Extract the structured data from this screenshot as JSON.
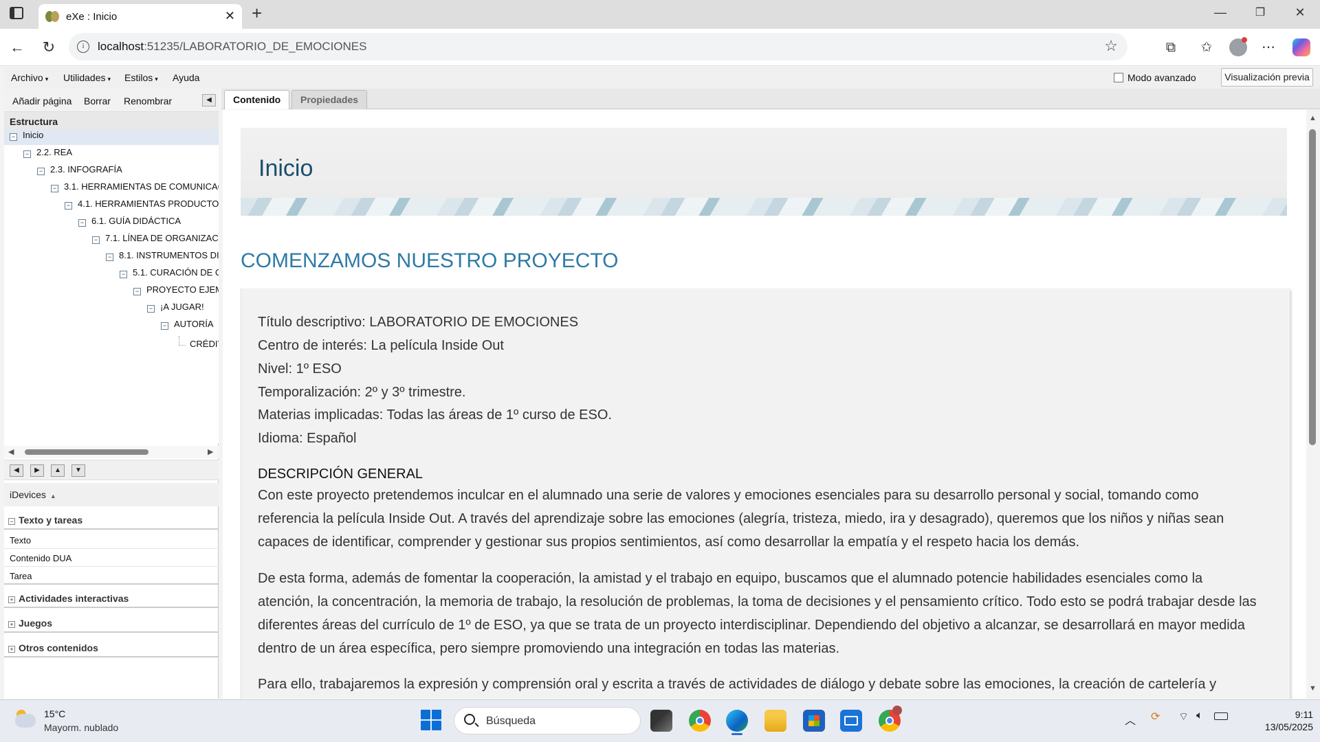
{
  "browser": {
    "tab_title": "eXe : Inicio",
    "url_host": "localhost",
    "url_rest": ":51235/LABORATORIO_DE_EMOCIONES"
  },
  "menu": {
    "archivo": "Archivo",
    "utilidades": "Utilidades",
    "estilos": "Estilos",
    "ayuda": "Ayuda",
    "modo_avanzado": "Modo avanzado",
    "visualizacion_previa": "Visualización previa"
  },
  "left": {
    "toolbar": {
      "add": "Añadir página",
      "delete": "Borrar",
      "rename": "Renombrar"
    },
    "estructura": "Estructura",
    "tree": [
      "Inicio",
      "2.2. REA",
      "2.3. INFOGRAFÍA",
      "3.1. HERRAMIENTAS DE COMUNICAC",
      "4.1. HERRAMIENTAS PRODUCTO",
      "6.1. GUÍA DIDÁCTICA",
      "7.1. LÍNEA DE ORGANIZAC",
      "8.1. INSTRUMENTOS DI",
      "5.1. CURACIÓN DE C",
      "PROYECTO EJEM",
      "¡A JUGAR!",
      "AUTORÍA",
      "CRÉDIT"
    ],
    "idevices_label": "iDevices",
    "categories": {
      "texto_tareas": "Texto y tareas",
      "actividades": "Actividades interactivas",
      "juegos": "Juegos",
      "otros": "Otros contenidos"
    },
    "idevice_items": [
      "Texto",
      "Contenido DUA",
      "Tarea"
    ]
  },
  "right": {
    "tabs": {
      "contenido": "Contenido",
      "propiedades": "Propiedades"
    },
    "page_title": "Inicio",
    "section_title": "COMENZAMOS NUESTRO PROYECTO",
    "info_lines": [
      "Título descriptivo: LABORATORIO DE EMOCIONES",
      "Centro de interés: La película Inside Out",
      "Nivel: 1º ESO",
      "Temporalización: 2º y 3º trimestre.",
      "Materias implicadas: Todas las áreas de 1º curso de ESO.",
      "Idioma: Español"
    ],
    "desc_heading": "DESCRIPCIÓN GENERAL",
    "paragraphs": [
      "Con este proyecto pretendemos inculcar en el alumnado una serie de valores y emociones esenciales para su desarrollo personal y social, tomando como referencia la película Inside Out. A través del aprendizaje sobre las emociones (alegría, tristeza, miedo, ira y desagrado), queremos que los niños y niñas sean capaces de identificar, comprender y gestionar sus propios sentimientos, así como desarrollar la empatía y el respeto hacia los demás.",
      "De esta forma, además de fomentar la cooperación, la amistad y el trabajo en equipo, buscamos que el alumnado potencie habilidades esenciales como la atención, la concentración, la memoria de trabajo, la resolución de problemas, la toma de decisiones y el pensamiento crítico. Todo esto se podrá trabajar desde las diferentes áreas del currículo de 1º de ESO, ya que se trata de un proyecto interdisciplinar. Dependiendo del objetivo a alcanzar, se desarrollará en mayor medida dentro de un área específica, pero siempre promoviendo una integración en todas las materias.",
      "Para ello, trabajaremos la expresión y comprensión oral y escrita a través de actividades de diálogo y debate sobre las emociones, la creación de cartelería y"
    ]
  },
  "taskbar": {
    "temp": "15°C",
    "weather": "Mayorm. nublado",
    "search_placeholder": "Búsqueda",
    "time": "9:11",
    "date": "13/05/2025"
  },
  "icons": [
    "tab-actions-icon",
    "favicon-icon",
    "close-tab-icon",
    "new-tab-icon",
    "minimize-icon",
    "maximize-icon",
    "close-window-icon",
    "back-icon",
    "reload-icon",
    "info-icon",
    "favorite-star-icon",
    "extensions-icon",
    "favorites-icon",
    "profile-icon",
    "more-icon",
    "copilot-icon"
  ]
}
